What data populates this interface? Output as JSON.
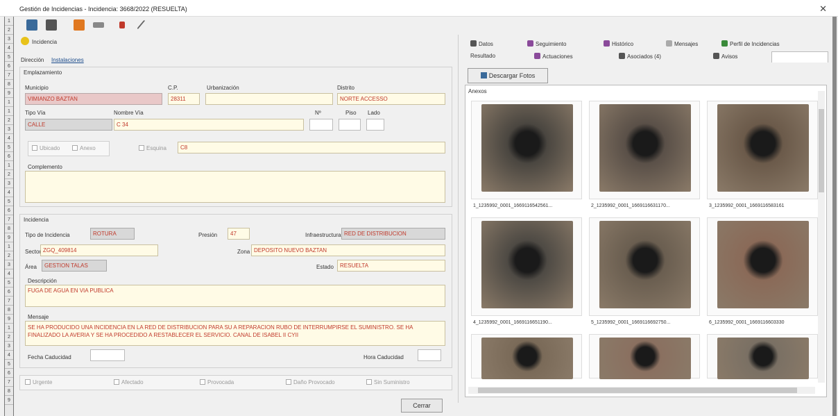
{
  "window": {
    "title": "Gestión de Incidencias - Incidencia: 3668/2022 (RESUELTA)",
    "close": "✕"
  },
  "gutter": [
    "1",
    "2",
    "3",
    "4",
    "5",
    "6",
    "7",
    "8",
    "9",
    "1",
    "1",
    "2",
    "3",
    "4",
    "5",
    "6",
    "1",
    "2",
    "3",
    "4",
    "5",
    "6",
    "7",
    "8",
    "9",
    "1",
    "2",
    "3",
    "4",
    "5",
    "6",
    "7",
    "8",
    "9",
    "1",
    "2",
    "3",
    "4",
    "5",
    "6",
    "7",
    "8",
    "9"
  ],
  "incidencia_tab": "Incidencia",
  "subtabs": {
    "direccion": "Dirección",
    "instalaciones": "Instalaciones"
  },
  "emplazamiento": {
    "legend": "Emplazamiento",
    "municipio_label": "Municipio",
    "municipio": "VIMIANZO BAZTAN",
    "cp_label": "C.P.",
    "cp": "28311",
    "urbanizacion_label": "Urbanización",
    "urbanizacion": "",
    "distrito_label": "Distrito",
    "distrito": "NORTE ACCESSO",
    "tipo_via_label": "Tipo Vía",
    "tipo_via": "CALLE",
    "nombre_via_label": "Nombre Vía",
    "nombre_via": "C 34",
    "n_label": "Nº",
    "n": "",
    "piso_label": "Piso",
    "piso": "",
    "lado_label": "Lado",
    "lado": "",
    "ubicado_label": "Ubicado",
    "anexo_label": "Anexo",
    "esquina_label": "Esquina",
    "esquina": "C8",
    "complemento_label": "Complemento",
    "complemento": ""
  },
  "incidencia": {
    "legend": "Incidencia",
    "tipo_label": "Tipo de Incidencia",
    "tipo": "ROTURA",
    "presion_label": "Presión",
    "presion": "47",
    "infra_label": "Infraestructura",
    "infra": "RED DE DISTRIBUCION",
    "sector_label": "Sector",
    "sector": "ZGQ_409814",
    "zona_label": "Zona",
    "zona": "DEPOSITO NUEVO BAZTAN",
    "area_label": "Área",
    "area": "GESTION TALAS",
    "estado_label": "Estado",
    "estado": "RESUELTA",
    "descripcion_label": "Descripción",
    "descripcion": "FUGA DE AGUA EN VIA PUBLICA",
    "mensaje_label": "Mensaje",
    "mensaje": "SE HA PRODUCIDO UNA INCIDENCIA EN LA RED DE DISTRIBUCION PARA SU A REPARACION RUBO DE INTERRUMPIRSE EL SUMINISTRO. SE HA FINALIZADO LA AVERIA Y SE HA PROCEDIDO A RESTABLECER EL SERVICIO. CANAL DE ISABEL II CYII",
    "fecha_cad_label": "Fecha Caducidad",
    "fecha_cad": "",
    "hora_cad_label": "Hora Caducidad",
    "hora_cad": ""
  },
  "flags": [
    "Urgente",
    "Afectado",
    "Provocada",
    "Daño Provocado",
    "Sin Suministro"
  ],
  "buttons": {
    "cerrar": "Cerrar",
    "descargar": "Descargar Fotos"
  },
  "right_tabs_row1": [
    "Datos",
    "Seguimiento",
    "Histórico",
    "Mensajes",
    "Perfil de Incidencias"
  ],
  "right_tabs_row2": [
    "Resultado",
    "Actuaciones",
    "Asociados (4)",
    "Avisos",
    "Anexos"
  ],
  "anexos_legend": "Anexos",
  "photos": [
    {
      "caption": "1_1235992_0001_1669116542561...",
      "color": "#4a4640"
    },
    {
      "caption": "2_1235992_0001_1669116631170...",
      "color": "#5a5048"
    },
    {
      "caption": "3_1235992_0001_1669116583161",
      "color": "#6b5a4a"
    },
    {
      "caption": "4_1235992_0001_1669116651190...",
      "color": "#4e4a44"
    },
    {
      "caption": "5_1235992_0001_1669116692750...",
      "color": "#6a5e50"
    },
    {
      "caption": "6_1235992_0001_1669116603330",
      "color": "#8a6a58"
    },
    {
      "caption": "",
      "color": "#7a6a58"
    },
    {
      "caption": "",
      "color": "#8a7060"
    },
    {
      "caption": "",
      "color": "#7a7064"
    }
  ]
}
